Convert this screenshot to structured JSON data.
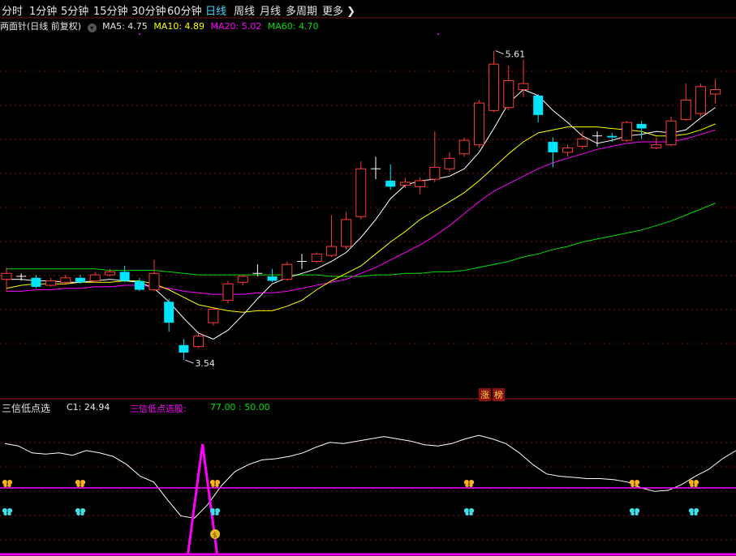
{
  "toolbar": {
    "tabs": [
      "分时",
      "1分钟",
      "5分钟",
      "15分钟",
      "30分钟",
      "60分钟",
      "日线",
      "周线",
      "月线",
      "多周期"
    ],
    "active_tab": "日线",
    "more_label": "更多"
  },
  "main_panel": {
    "title": "两面针(日线 前复权)",
    "ma5": "MA5: 4.75",
    "ma10": "MA10: 4.89",
    "ma20": "MA20: 5.02",
    "ma60": "MA60: 4.70",
    "high_label": "5.61",
    "low_label": "3.54",
    "zhang_label": "涨",
    "bang_label": "榜",
    "colors": {
      "up": "#ff3b3b",
      "down": "#00e5ff",
      "ma5": "#ffffff",
      "ma10": "#ffff00",
      "ma20": "#ff00ff",
      "ma60": "#00dd00"
    }
  },
  "indicator_panel": {
    "name": "三信低点选",
    "c1": "C1: 24.94",
    "signal_label": "三信低点选股:",
    "signal_values": "77.00 : 50.00",
    "colors": {
      "line": "#ffffff",
      "signal": "#ff00ff"
    }
  },
  "chart_data": [
    {
      "type": "candlestick",
      "title": "两面针(日线 前复权)",
      "ylim": [
        3.4,
        5.7
      ],
      "candles": [
        {
          "o": 4.08,
          "c": 4.12,
          "h": 4.16,
          "l": 4.0,
          "up": true
        },
        {
          "o": 4.1,
          "c": 4.1,
          "h": 4.12,
          "l": 4.07,
          "up": false
        },
        {
          "o": 4.09,
          "c": 4.03,
          "h": 4.11,
          "l": 4.02,
          "up": false
        },
        {
          "o": 4.04,
          "c": 4.07,
          "h": 4.09,
          "l": 4.03,
          "up": true
        },
        {
          "o": 4.06,
          "c": 4.09,
          "h": 4.11,
          "l": 4.05,
          "up": true
        },
        {
          "o": 4.09,
          "c": 4.06,
          "h": 4.11,
          "l": 4.05,
          "up": false
        },
        {
          "o": 4.07,
          "c": 4.11,
          "h": 4.13,
          "l": 4.06,
          "up": true
        },
        {
          "o": 4.11,
          "c": 4.13,
          "h": 4.15,
          "l": 4.1,
          "up": true
        },
        {
          "o": 4.13,
          "c": 4.07,
          "h": 4.17,
          "l": 4.06,
          "up": false
        },
        {
          "o": 4.07,
          "c": 4.01,
          "h": 4.09,
          "l": 4.0,
          "up": false
        },
        {
          "o": 4.01,
          "c": 4.12,
          "h": 4.21,
          "l": 4.0,
          "up": true
        },
        {
          "o": 3.93,
          "c": 3.79,
          "h": 3.95,
          "l": 3.73,
          "up": false
        },
        {
          "o": 3.64,
          "c": 3.59,
          "h": 3.68,
          "l": 3.54,
          "up": false
        },
        {
          "o": 3.63,
          "c": 3.7,
          "h": 3.72,
          "l": 3.62,
          "up": true
        },
        {
          "o": 3.79,
          "c": 3.88,
          "h": 3.89,
          "l": 3.77,
          "up": true
        },
        {
          "o": 3.94,
          "c": 4.05,
          "h": 4.07,
          "l": 3.92,
          "up": true
        },
        {
          "o": 4.06,
          "c": 4.1,
          "h": 4.11,
          "l": 4.04,
          "up": true
        },
        {
          "o": 4.12,
          "c": 4.12,
          "h": 4.18,
          "l": 4.1,
          "up": true
        },
        {
          "o": 4.1,
          "c": 4.07,
          "h": 4.15,
          "l": 4.06,
          "up": false
        },
        {
          "o": 4.08,
          "c": 4.18,
          "h": 4.2,
          "l": 4.07,
          "up": true
        },
        {
          "o": 4.2,
          "c": 4.2,
          "h": 4.25,
          "l": 4.15,
          "up": false
        },
        {
          "o": 4.2,
          "c": 4.25,
          "h": 4.26,
          "l": 4.19,
          "up": true
        },
        {
          "o": 4.24,
          "c": 4.3,
          "h": 4.51,
          "l": 4.23,
          "up": true
        },
        {
          "o": 4.3,
          "c": 4.48,
          "h": 4.53,
          "l": 4.28,
          "up": true
        },
        {
          "o": 4.5,
          "c": 4.82,
          "h": 4.87,
          "l": 4.48,
          "up": true
        },
        {
          "o": 4.82,
          "c": 4.82,
          "h": 4.9,
          "l": 4.75,
          "up": false
        },
        {
          "o": 4.74,
          "c": 4.7,
          "h": 4.85,
          "l": 4.68,
          "up": false
        },
        {
          "o": 4.71,
          "c": 4.73,
          "h": 4.76,
          "l": 4.69,
          "up": true
        },
        {
          "o": 4.7,
          "c": 4.74,
          "h": 4.76,
          "l": 4.65,
          "up": true
        },
        {
          "o": 4.75,
          "c": 4.83,
          "h": 5.07,
          "l": 4.73,
          "up": true
        },
        {
          "o": 4.82,
          "c": 4.89,
          "h": 4.93,
          "l": 4.8,
          "up": true
        },
        {
          "o": 4.92,
          "c": 5.01,
          "h": 5.03,
          "l": 4.9,
          "up": true
        },
        {
          "o": 4.98,
          "c": 5.26,
          "h": 5.28,
          "l": 4.96,
          "up": true
        },
        {
          "o": 5.21,
          "c": 5.52,
          "h": 5.61,
          "l": 5.2,
          "up": true
        },
        {
          "o": 5.23,
          "c": 5.41,
          "h": 5.51,
          "l": 5.21,
          "up": true
        },
        {
          "o": 5.35,
          "c": 5.39,
          "h": 5.55,
          "l": 5.3,
          "up": true
        },
        {
          "o": 5.31,
          "c": 5.18,
          "h": 5.32,
          "l": 5.13,
          "up": false
        },
        {
          "o": 5.0,
          "c": 4.93,
          "h": 5.03,
          "l": 4.83,
          "up": false
        },
        {
          "o": 4.93,
          "c": 4.96,
          "h": 4.98,
          "l": 4.9,
          "up": true
        },
        {
          "o": 4.97,
          "c": 5.02,
          "h": 5.07,
          "l": 4.95,
          "up": true
        },
        {
          "o": 5.04,
          "c": 5.04,
          "h": 5.07,
          "l": 4.97,
          "up": false
        },
        {
          "o": 5.04,
          "c": 5.03,
          "h": 5.06,
          "l": 5.0,
          "up": false
        },
        {
          "o": 5.01,
          "c": 5.13,
          "h": 5.14,
          "l": 5.0,
          "up": true
        },
        {
          "o": 5.12,
          "c": 5.09,
          "h": 5.14,
          "l": 5.02,
          "up": false
        },
        {
          "o": 4.96,
          "c": 4.98,
          "h": 5.03,
          "l": 4.95,
          "up": true
        },
        {
          "o": 4.98,
          "c": 5.14,
          "h": 5.17,
          "l": 4.97,
          "up": true
        },
        {
          "o": 5.15,
          "c": 5.28,
          "h": 5.39,
          "l": 5.14,
          "up": true
        },
        {
          "o": 5.19,
          "c": 5.37,
          "h": 5.39,
          "l": 5.17,
          "up": true
        },
        {
          "o": 5.32,
          "c": 5.35,
          "h": 5.42,
          "l": 5.26,
          "up": true
        }
      ],
      "ma5": [
        4.08,
        4.08,
        4.07,
        4.07,
        4.06,
        4.06,
        4.07,
        4.08,
        4.07,
        4.06,
        4.02,
        3.93,
        3.82,
        3.72,
        3.68,
        3.74,
        3.84,
        3.95,
        4.05,
        4.09,
        4.12,
        4.15,
        4.2,
        4.26,
        4.36,
        4.48,
        4.62,
        4.71,
        4.74,
        4.75,
        4.77,
        4.82,
        4.93,
        5.09,
        5.26,
        5.35,
        5.31,
        5.21,
        5.13,
        5.04,
        4.99,
        5.01,
        5.04,
        5.05,
        5.07,
        5.06,
        5.08,
        5.16,
        5.23
      ],
      "ma10": [
        4.02,
        4.04,
        4.05,
        4.05,
        4.05,
        4.06,
        4.06,
        4.06,
        4.07,
        4.07,
        4.05,
        4.01,
        3.96,
        3.91,
        3.89,
        3.87,
        3.86,
        3.87,
        3.87,
        3.9,
        3.94,
        4.01,
        4.07,
        4.12,
        4.17,
        4.25,
        4.33,
        4.4,
        4.48,
        4.54,
        4.6,
        4.66,
        4.74,
        4.83,
        4.92,
        5.0,
        5.06,
        5.08,
        5.1,
        5.1,
        5.1,
        5.09,
        5.08,
        5.07,
        5.04,
        5.04,
        5.05,
        5.08,
        5.12
      ],
      "ma20": [
        4.0,
        4.0,
        4.01,
        4.01,
        4.02,
        4.02,
        4.03,
        4.03,
        4.04,
        4.04,
        4.03,
        4.02,
        4.0,
        3.99,
        3.98,
        3.98,
        3.98,
        3.99,
        3.99,
        4.0,
        4.02,
        4.04,
        4.06,
        4.08,
        4.12,
        4.16,
        4.21,
        4.26,
        4.31,
        4.37,
        4.44,
        4.52,
        4.6,
        4.67,
        4.72,
        4.77,
        4.82,
        4.86,
        4.89,
        4.92,
        4.95,
        4.97,
        4.99,
        5.0,
        5.0,
        5.0,
        5.02,
        5.05,
        5.08
      ],
      "ma60": [
        4.15,
        4.15,
        4.15,
        4.15,
        4.15,
        4.15,
        4.15,
        4.14,
        4.14,
        4.14,
        4.14,
        4.13,
        4.12,
        4.11,
        4.11,
        4.11,
        4.11,
        4.11,
        4.11,
        4.11,
        4.11,
        4.11,
        4.1,
        4.1,
        4.1,
        4.11,
        4.11,
        4.12,
        4.12,
        4.13,
        4.13,
        4.14,
        4.16,
        4.18,
        4.2,
        4.23,
        4.25,
        4.28,
        4.3,
        4.33,
        4.35,
        4.37,
        4.39,
        4.41,
        4.44,
        4.47,
        4.51,
        4.55,
        4.59
      ]
    },
    {
      "type": "line",
      "title": "三信低点选",
      "ylim": [
        0,
        100
      ],
      "series": [
        {
          "name": "C1",
          "values": [
            88,
            86,
            80,
            79,
            80,
            78,
            82,
            80,
            77,
            70,
            60,
            55,
            40,
            26,
            24,
            36,
            52,
            64,
            70,
            74,
            75,
            77,
            80,
            85,
            89,
            88,
            90,
            92,
            94,
            92,
            90,
            87,
            86,
            88,
            92,
            95,
            92,
            88,
            80,
            70,
            62,
            60,
            59,
            58,
            58,
            57,
            55,
            50,
            47,
            48,
            53,
            60,
            66,
            75,
            82
          ]
        },
        {
          "name": "三信低点选股",
          "values": [
            50
          ]
        }
      ],
      "signal_spike_index": 14
    }
  ]
}
